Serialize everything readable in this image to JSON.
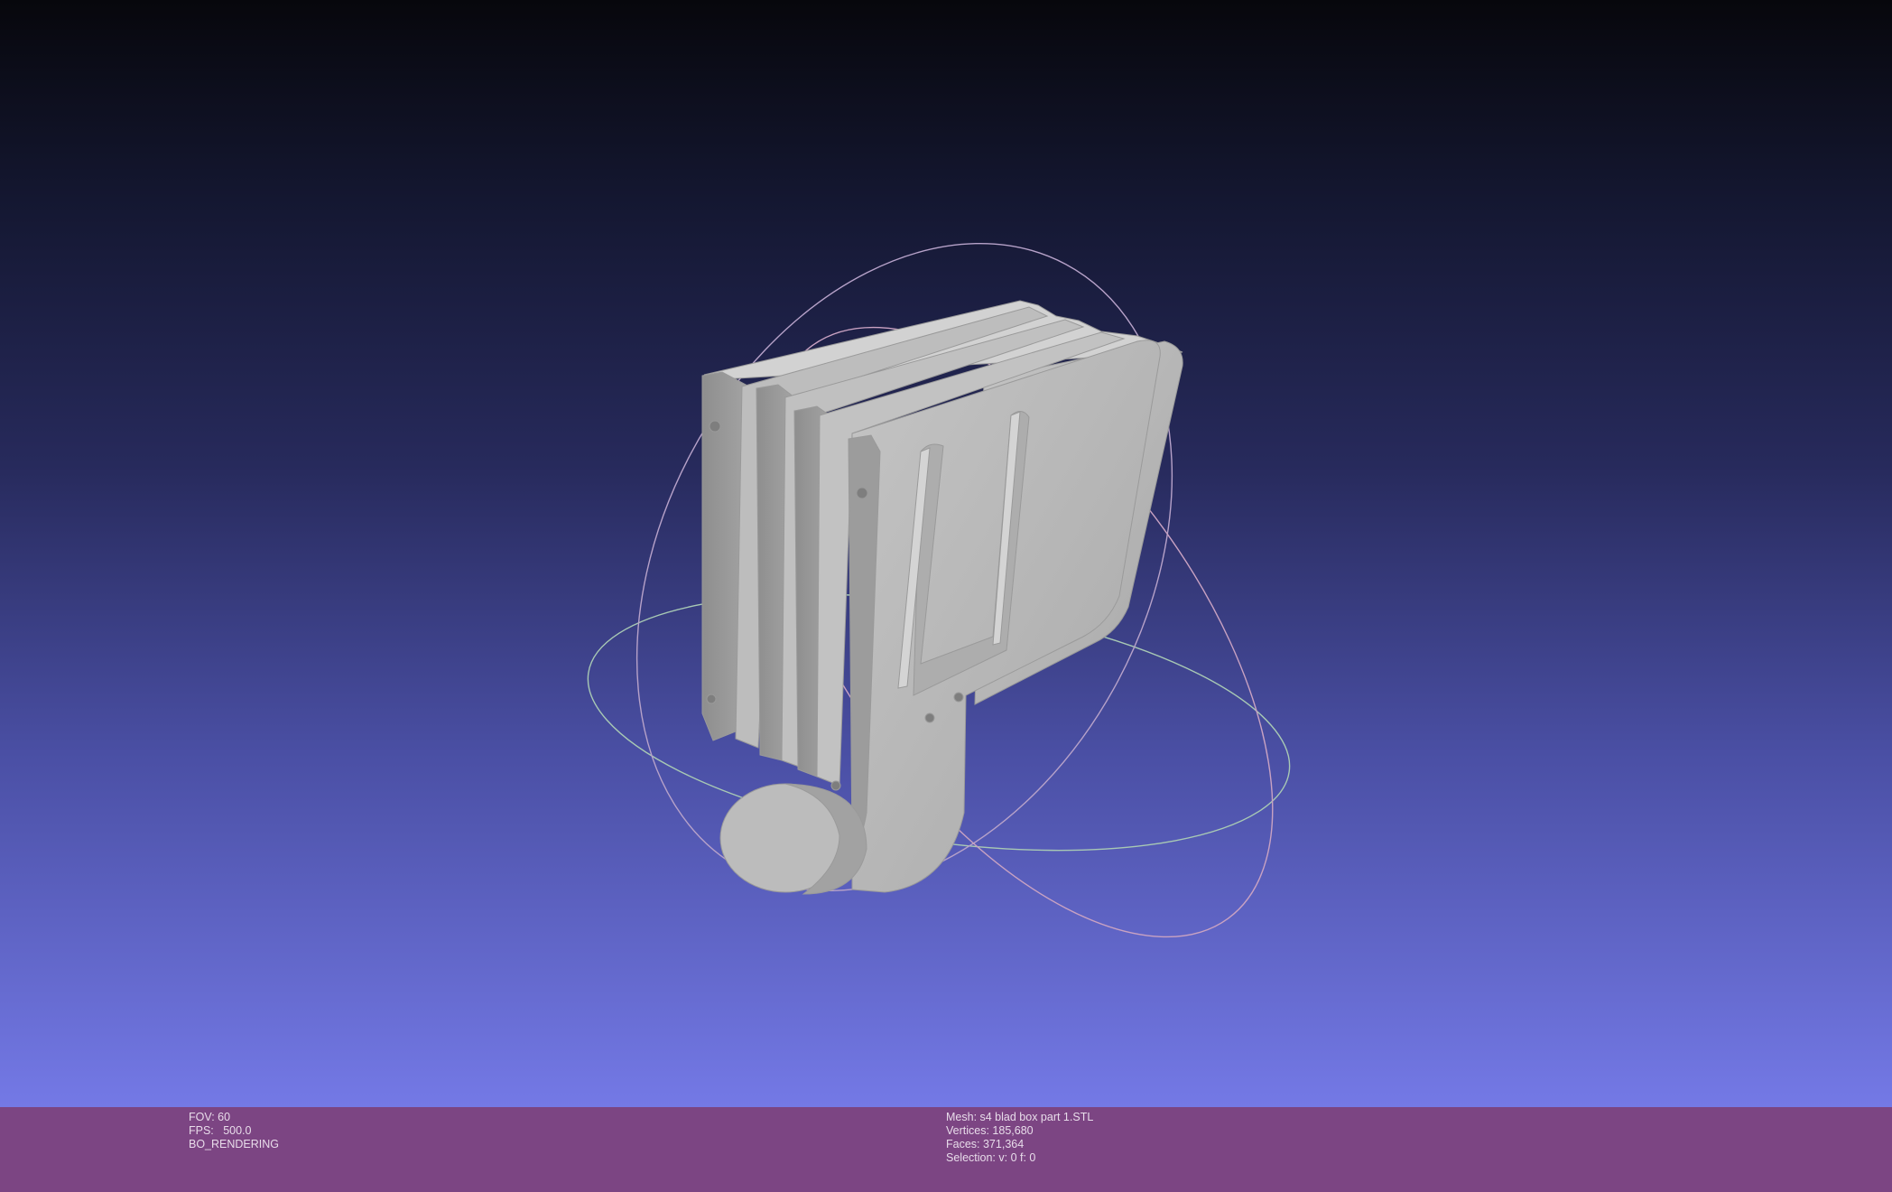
{
  "viewport": {
    "background_top": "#07070c",
    "background_bottom": "#7479e6",
    "model_color": "#b8b8b8",
    "trackball_colors": [
      "#b7a2c9",
      "#a8c9b4",
      "#c9a2c2"
    ]
  },
  "status_bar": {
    "background": "#7c4583",
    "left": {
      "fov": "FOV: 60",
      "fps": "FPS:   500.0",
      "mode": "BO_RENDERING"
    },
    "right": {
      "mesh": "Mesh: s4 blad box part 1.STL",
      "vertices": "Vertices: 185,680",
      "faces": "Faces: 371,364",
      "selection": "Selection: v: 0 f: 0"
    }
  }
}
